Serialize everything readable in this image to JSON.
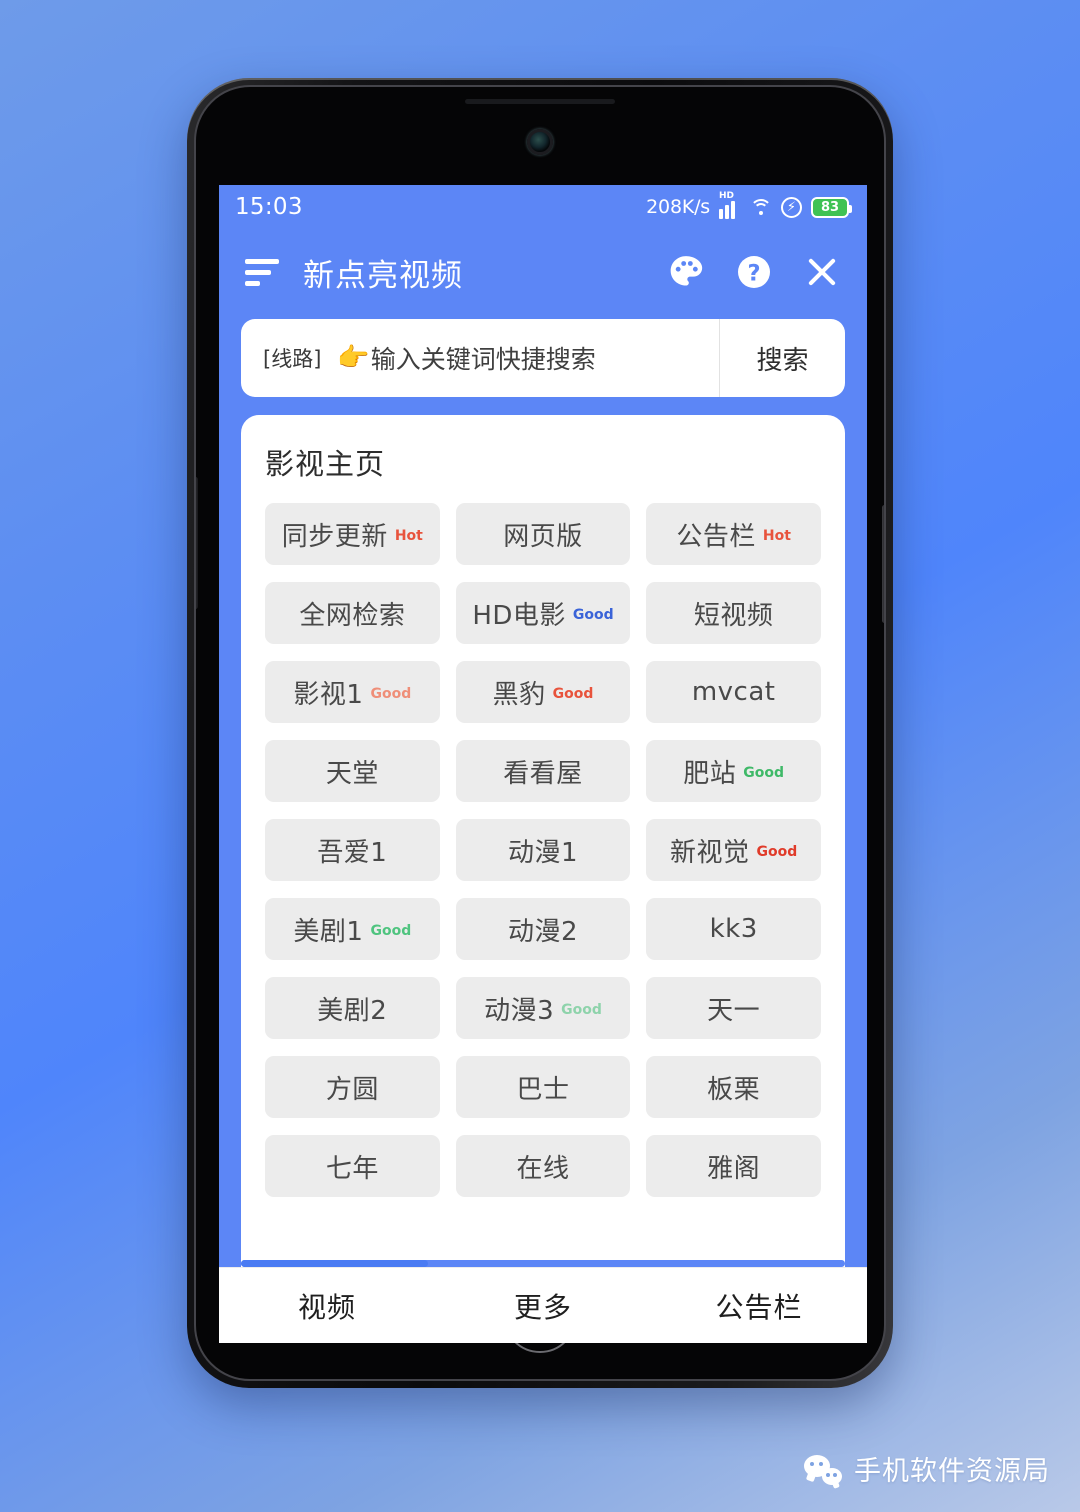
{
  "status_bar": {
    "time": "15:03",
    "net_speed": "208K/s",
    "hd_label": "HD",
    "battery_level": "83",
    "icons": [
      "signal-icon",
      "wifi-icon",
      "charging-bolt-icon",
      "battery-icon"
    ]
  },
  "app_bar": {
    "title": "新点亮视频",
    "menu_icon": "menu-icon",
    "palette_icon": "palette-icon",
    "help_icon": "help-icon",
    "close_icon": "close-icon"
  },
  "search": {
    "route_tag": "[线路]",
    "hand_icon": "👉",
    "placeholder": "输入关键词快捷搜索",
    "button_label": "搜索"
  },
  "content": {
    "title": "影视主页",
    "tiles": [
      {
        "label": "同步更新",
        "badge": "Hot",
        "badge_color": "#e8533c"
      },
      {
        "label": "网页版",
        "badge": "",
        "badge_color": ""
      },
      {
        "label": "公告栏",
        "badge": "Hot",
        "badge_color": "#e8533c"
      },
      {
        "label": "全网检索",
        "badge": "",
        "badge_color": ""
      },
      {
        "label": "HD电影",
        "badge": "Good",
        "badge_color": "#3a63d8"
      },
      {
        "label": "短视频",
        "badge": "",
        "badge_color": ""
      },
      {
        "label": "影视1",
        "badge": "Good",
        "badge_color": "#ef8e78"
      },
      {
        "label": "黑豹",
        "badge": "Good",
        "badge_color": "#e8533c"
      },
      {
        "label": "mvcat",
        "badge": "",
        "badge_color": ""
      },
      {
        "label": "天堂",
        "badge": "",
        "badge_color": ""
      },
      {
        "label": "看看屋",
        "badge": "",
        "badge_color": ""
      },
      {
        "label": "肥站",
        "badge": "Good",
        "badge_color": "#3fb968"
      },
      {
        "label": "吾爱1",
        "badge": "",
        "badge_color": ""
      },
      {
        "label": "动漫1",
        "badge": "",
        "badge_color": ""
      },
      {
        "label": "新视觉",
        "badge": "Good",
        "badge_color": "#e03b2a"
      },
      {
        "label": "美剧1",
        "badge": "Good",
        "badge_color": "#4fc47f"
      },
      {
        "label": "动漫2",
        "badge": "",
        "badge_color": ""
      },
      {
        "label": "kk3",
        "badge": "",
        "badge_color": ""
      },
      {
        "label": "美剧2",
        "badge": "",
        "badge_color": ""
      },
      {
        "label": "动漫3",
        "badge": "Good",
        "badge_color": "#8ed3ab"
      },
      {
        "label": "天一",
        "badge": "",
        "badge_color": ""
      },
      {
        "label": "方圆",
        "badge": "",
        "badge_color": ""
      },
      {
        "label": "巴士",
        "badge": "",
        "badge_color": ""
      },
      {
        "label": "板栗",
        "badge": "",
        "badge_color": ""
      },
      {
        "label": "七年",
        "badge": "",
        "badge_color": ""
      },
      {
        "label": "在线",
        "badge": "",
        "badge_color": ""
      },
      {
        "label": "雅阁",
        "badge": "",
        "badge_color": ""
      }
    ]
  },
  "bottom_nav": {
    "items": [
      {
        "label": "视频"
      },
      {
        "label": "更多"
      },
      {
        "label": "公告栏"
      }
    ]
  },
  "watermark": {
    "text": "手机软件资源局",
    "icon": "wechat-icon"
  },
  "theme": {
    "app_blue": "#5c86f6",
    "tile_bg": "#ececec",
    "battery_green": "#3fc254"
  }
}
